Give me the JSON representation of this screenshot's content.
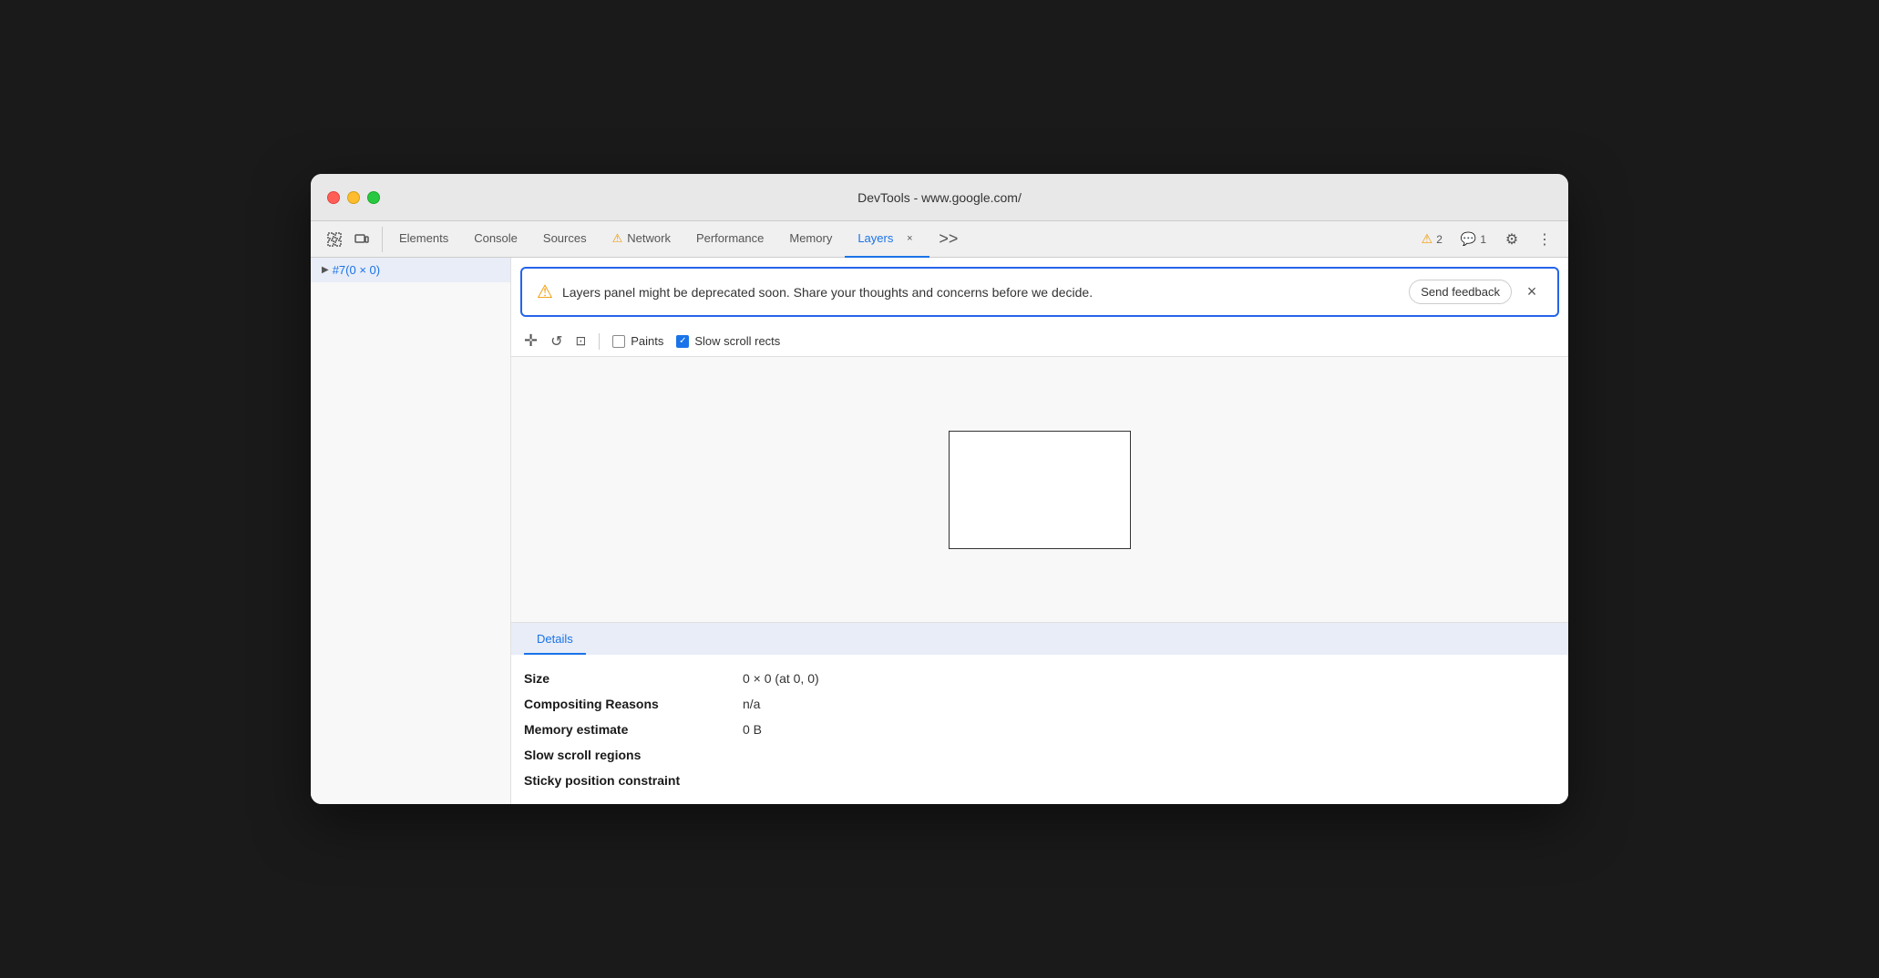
{
  "window": {
    "title": "DevTools - www.google.com/"
  },
  "tabs": {
    "items": [
      {
        "id": "elements",
        "label": "Elements",
        "active": false,
        "hasWarning": false
      },
      {
        "id": "console",
        "label": "Console",
        "active": false,
        "hasWarning": false
      },
      {
        "id": "sources",
        "label": "Sources",
        "active": false,
        "hasWarning": false
      },
      {
        "id": "network",
        "label": "Network",
        "active": false,
        "hasWarning": true
      },
      {
        "id": "performance",
        "label": "Performance",
        "active": false,
        "hasWarning": false
      },
      {
        "id": "memory",
        "label": "Memory",
        "active": false,
        "hasWarning": false
      },
      {
        "id": "layers",
        "label": "Layers",
        "active": true,
        "hasWarning": false
      }
    ],
    "overflow_label": ">>",
    "warnings_count": "2",
    "comments_count": "1"
  },
  "banner": {
    "text": "Layers panel might be deprecated soon. Share your thoughts and concerns before we decide.",
    "send_feedback_label": "Send feedback",
    "close_icon": "×"
  },
  "toolbar": {
    "paints_label": "Paints",
    "slow_scroll_rects_label": "Slow scroll rects",
    "slow_scroll_checked": true
  },
  "sidebar": {
    "items": [
      {
        "label": "#7(0 × 0)",
        "selected": true
      }
    ]
  },
  "details": {
    "header_label": "Details",
    "rows": [
      {
        "label": "Size",
        "value": "0 × 0 (at 0, 0)"
      },
      {
        "label": "Compositing Reasons",
        "value": "n/a"
      },
      {
        "label": "Memory estimate",
        "value": "0 B"
      },
      {
        "label": "Slow scroll regions",
        "value": ""
      },
      {
        "label": "Sticky position constraint",
        "value": ""
      }
    ]
  }
}
